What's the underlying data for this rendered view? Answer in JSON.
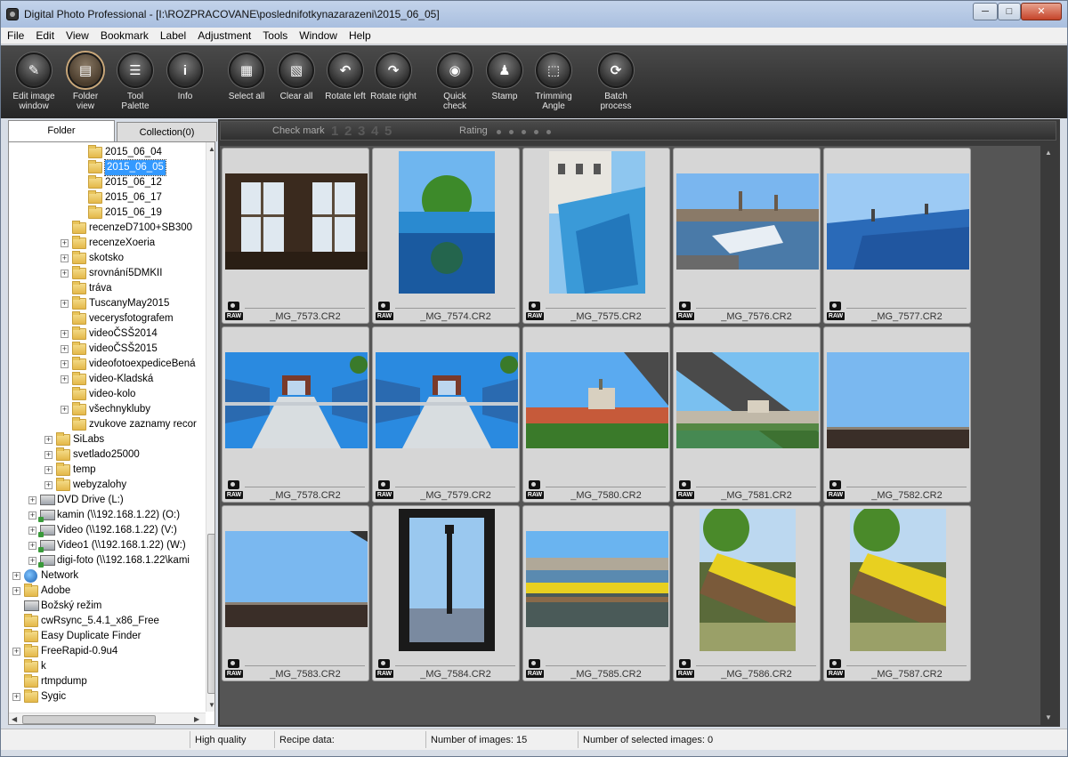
{
  "window": {
    "title": "Digital Photo Professional - [I:\\ROZPRACOVANE\\poslednifotkynazarazeni\\2015_06_05]",
    "min": "─",
    "max": "□",
    "close": "✕"
  },
  "menu": [
    "File",
    "Edit",
    "View",
    "Bookmark",
    "Label",
    "Adjustment",
    "Tools",
    "Window",
    "Help"
  ],
  "toolbar": [
    {
      "label1": "Edit image",
      "label2": "window",
      "icon": "edit-image-window-icon",
      "glyph": "✎"
    },
    {
      "label1": "Folder",
      "label2": "view",
      "icon": "folder-view-icon",
      "glyph": "▤",
      "active": true
    },
    {
      "label1": "Tool",
      "label2": "Palette",
      "icon": "tool-palette-icon",
      "glyph": "☰"
    },
    {
      "label1": "Info",
      "label2": "",
      "icon": "info-icon",
      "glyph": "i"
    },
    {
      "label1": "Select all",
      "label2": "",
      "icon": "select-all-icon",
      "glyph": "▦"
    },
    {
      "label1": "Clear all",
      "label2": "",
      "icon": "clear-all-icon",
      "glyph": "▧"
    },
    {
      "label1": "Rotate left",
      "label2": "",
      "icon": "rotate-left-icon",
      "glyph": "↶"
    },
    {
      "label1": "Rotate right",
      "label2": "",
      "icon": "rotate-right-icon",
      "glyph": "↷"
    },
    {
      "label1": "Quick",
      "label2": "check",
      "icon": "quick-check-icon",
      "glyph": "◉"
    },
    {
      "label1": "Stamp",
      "label2": "",
      "icon": "stamp-icon",
      "glyph": "♟"
    },
    {
      "label1": "Trimming",
      "label2": "Angle",
      "icon": "trimming-angle-icon",
      "glyph": "⬚"
    },
    {
      "label1": "Batch",
      "label2": "process",
      "icon": "batch-process-icon",
      "glyph": "⟳"
    }
  ],
  "tabs": {
    "folder": "Folder",
    "collection": "Collection(0)"
  },
  "filter": {
    "checkmark_label": "Check mark",
    "checkmarks": [
      "1",
      "2",
      "3",
      "4",
      "5"
    ],
    "rating_label": "Rating"
  },
  "tree": [
    {
      "label": "2015_06_04",
      "indent": 4,
      "type": "folder",
      "exp": false
    },
    {
      "label": "2015_06_05",
      "indent": 4,
      "type": "folder",
      "exp": false,
      "selected": true
    },
    {
      "label": "2015_06_12",
      "indent": 4,
      "type": "folder",
      "exp": false
    },
    {
      "label": "2015_06_17",
      "indent": 4,
      "type": "folder",
      "exp": false
    },
    {
      "label": "2015_06_19",
      "indent": 4,
      "type": "folder",
      "exp": false
    },
    {
      "label": "recenzeD7100+SB300",
      "indent": 3,
      "type": "folder",
      "exp": false
    },
    {
      "label": "recenzeXoeria",
      "indent": 3,
      "type": "folder",
      "exp": true
    },
    {
      "label": "skotsko",
      "indent": 3,
      "type": "folder",
      "exp": true
    },
    {
      "label": "srovnání5DMKII",
      "indent": 3,
      "type": "folder",
      "exp": true
    },
    {
      "label": "tráva",
      "indent": 3,
      "type": "folder",
      "exp": false
    },
    {
      "label": "TuscanyMay2015",
      "indent": 3,
      "type": "folder",
      "exp": true
    },
    {
      "label": "vecerysfotografem",
      "indent": 3,
      "type": "folder",
      "exp": false
    },
    {
      "label": "videoČSŠ2014",
      "indent": 3,
      "type": "folder",
      "exp": true
    },
    {
      "label": "videoČSŠ2015",
      "indent": 3,
      "type": "folder",
      "exp": true
    },
    {
      "label": "videofotoexpediceBená",
      "indent": 3,
      "type": "folder",
      "exp": true
    },
    {
      "label": "video-Kladská",
      "indent": 3,
      "type": "folder",
      "exp": true
    },
    {
      "label": "video-kolo",
      "indent": 3,
      "type": "folder",
      "exp": false
    },
    {
      "label": "všechnykluby",
      "indent": 3,
      "type": "folder",
      "exp": true
    },
    {
      "label": "zvukove zaznamy recor",
      "indent": 3,
      "type": "folder",
      "exp": false
    },
    {
      "label": "SiLabs",
      "indent": 2,
      "type": "folder",
      "exp": true
    },
    {
      "label": "svetlado25000",
      "indent": 2,
      "type": "folder",
      "exp": true
    },
    {
      "label": "temp",
      "indent": 2,
      "type": "folder",
      "exp": true
    },
    {
      "label": "webyzalohy",
      "indent": 2,
      "type": "folder",
      "exp": true
    },
    {
      "label": "DVD Drive (L:)",
      "indent": 1,
      "type": "drive",
      "exp": true
    },
    {
      "label": "kamin (\\\\192.168.1.22) (O:)",
      "indent": 1,
      "type": "netdrive",
      "exp": true
    },
    {
      "label": "Video (\\\\192.168.1.22) (V:)",
      "indent": 1,
      "type": "netdrive",
      "exp": true
    },
    {
      "label": "Video1 (\\\\192.168.1.22) (W:)",
      "indent": 1,
      "type": "netdrive",
      "exp": true
    },
    {
      "label": "digi-foto (\\\\192.168.1.22\\kami",
      "indent": 1,
      "type": "netdrive",
      "exp": true
    },
    {
      "label": "Network",
      "indent": 0,
      "type": "globe",
      "exp": true
    },
    {
      "label": "Adobe",
      "indent": 0,
      "type": "folder",
      "exp": true
    },
    {
      "label": "Božský režim",
      "indent": 0,
      "type": "drive",
      "exp": false
    },
    {
      "label": "cwRsync_5.4.1_x86_Free",
      "indent": 0,
      "type": "folder",
      "exp": false
    },
    {
      "label": "Easy Duplicate Finder",
      "indent": 0,
      "type": "folder",
      "exp": false
    },
    {
      "label": "FreeRapid-0.9u4",
      "indent": 0,
      "type": "folder",
      "exp": true
    },
    {
      "label": "k",
      "indent": 0,
      "type": "folder",
      "exp": false
    },
    {
      "label": "rtmpdump",
      "indent": 0,
      "type": "folder",
      "exp": false
    },
    {
      "label": "Sygic",
      "indent": 0,
      "type": "folder",
      "exp": true
    }
  ],
  "thumbnails": [
    {
      "name": "_MG_7573.CR2",
      "scene": "windows",
      "orient": "land"
    },
    {
      "name": "_MG_7574.CR2",
      "scene": "tree-glass",
      "orient": "port"
    },
    {
      "name": "_MG_7575.CR2",
      "scene": "building-glass",
      "orient": "port"
    },
    {
      "name": "_MG_7576.CR2",
      "scene": "river-weir",
      "orient": "land"
    },
    {
      "name": "_MG_7577.CR2",
      "scene": "blue-glass",
      "orient": "land"
    },
    {
      "name": "_MG_7578.CR2",
      "scene": "terrace",
      "orient": "land"
    },
    {
      "name": "_MG_7579.CR2",
      "scene": "terrace",
      "orient": "land"
    },
    {
      "name": "_MG_7580.CR2",
      "scene": "castle-view",
      "orient": "land"
    },
    {
      "name": "_MG_7581.CR2",
      "scene": "castle-frame",
      "orient": "land"
    },
    {
      "name": "_MG_7582.CR2",
      "scene": "sky-roof",
      "orient": "land"
    },
    {
      "name": "_MG_7583.CR2",
      "scene": "sky-roof2",
      "orient": "land"
    },
    {
      "name": "_MG_7584.CR2",
      "scene": "statue",
      "orient": "port"
    },
    {
      "name": "_MG_7585.CR2",
      "scene": "river-yellow",
      "orient": "land"
    },
    {
      "name": "_MG_7586.CR2",
      "scene": "yellow-boats",
      "orient": "port"
    },
    {
      "name": "_MG_7587.CR2",
      "scene": "yellow-boats",
      "orient": "port"
    }
  ],
  "raw_badge": "RAW",
  "status": {
    "quality": "High quality",
    "recipe": "Recipe data:",
    "num_images": "Number of images: 15",
    "num_selected": "Number of selected images: 0"
  }
}
